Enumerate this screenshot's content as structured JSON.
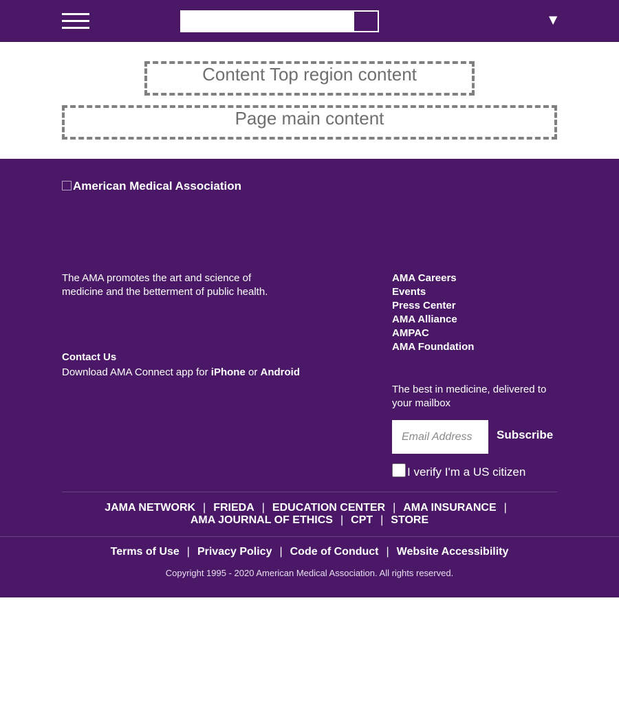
{
  "header": {
    "search_placeholder": "",
    "dropdown_arrow": "▼"
  },
  "content": {
    "top_region": "Content Top region content",
    "main_region": "Page main content"
  },
  "footer": {
    "logo_alt": "American Medical Association",
    "tagline": "The AMA promotes the art and science of medicine and the betterment of public health.",
    "contact_us": "Contact Us",
    "download": {
      "prefix": "Download AMA Connect app for ",
      "iphone": "iPhone",
      "or": " or ",
      "android": "Android"
    },
    "links": [
      "AMA Careers",
      "Events",
      "Press Center",
      "AMA Alliance",
      "AMPAC",
      "AMA Foundation"
    ],
    "newsletter": {
      "text": "The best in medicine, delivered to your mailbox",
      "email_placeholder": "Email Address",
      "subscribe_label": "Subscribe",
      "verify_label": "I verify I'm a US citizen"
    },
    "nav_row_1": [
      "JAMA NETWORK",
      "FRIEDA",
      "EDUCATION CENTER",
      "AMA INSURANCE"
    ],
    "nav_row_2": [
      "AMA JOURNAL OF ETHICS",
      "CPT",
      "STORE"
    ],
    "separator": "|",
    "legal": [
      "Terms of Use",
      "Privacy Policy",
      "Code of Conduct",
      "Website Accessibility"
    ],
    "copyright": "Copyright 1995 - 2020 American Medical Association. All rights reserved."
  },
  "colors": {
    "brand_purple": "#4a1866",
    "region_border": "#808080"
  }
}
